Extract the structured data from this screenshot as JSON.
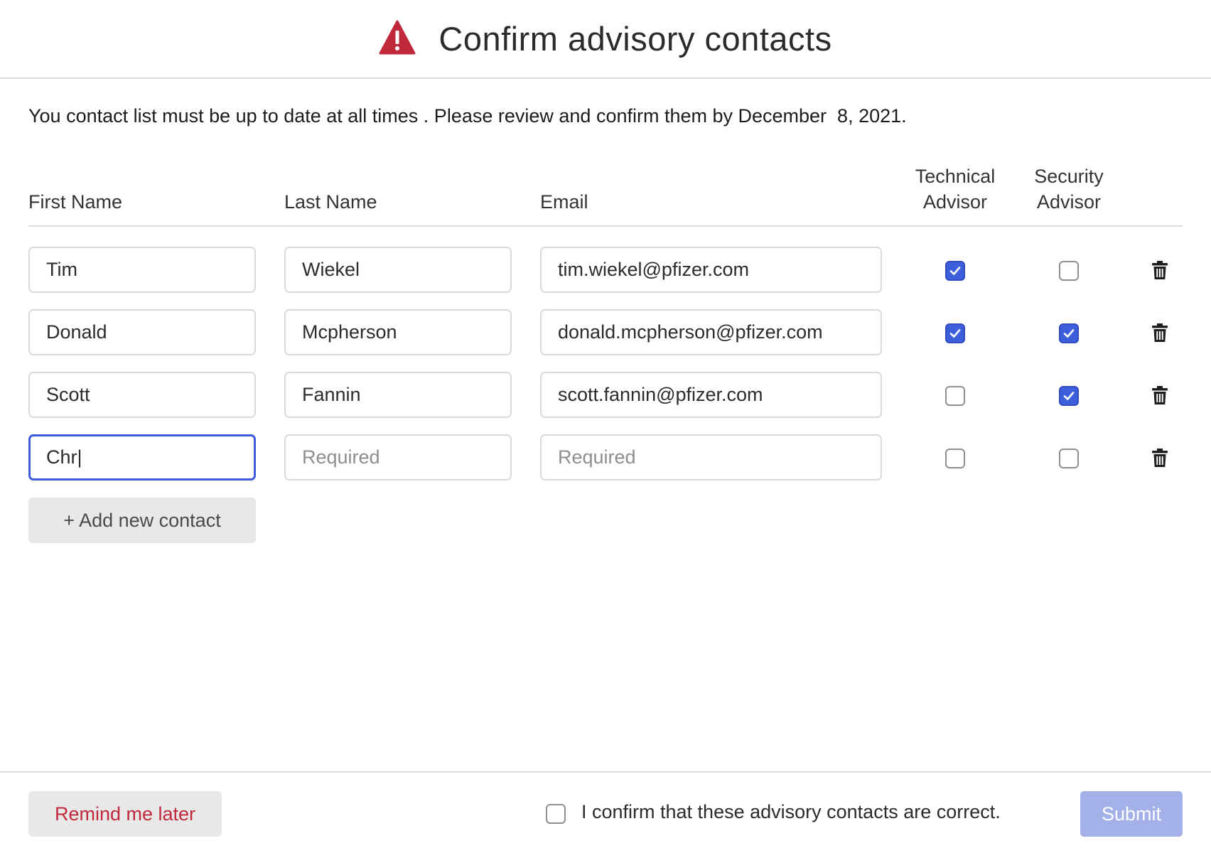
{
  "header": {
    "title": "Confirm advisory contacts",
    "icon": "warning-icon",
    "icon_color": "#c0283c"
  },
  "notice": "You contact list must be up to date at all times . Please review and confirm them by December  8, 2021.",
  "columns": {
    "first_name": "First Name",
    "last_name": "Last Name",
    "email": "Email",
    "technical_line1": "Technical",
    "technical_line2": "Advisor",
    "security_line1": "Security",
    "security_line2": "Advisor"
  },
  "rows": [
    {
      "first": "Tim",
      "last": "Wiekel",
      "email": "tim.wiekel@pfizer.com",
      "technical": true,
      "security": false
    },
    {
      "first": "Donald",
      "last": "Mcpherson",
      "email": "donald.mcpherson@pfizer.com",
      "technical": true,
      "security": true
    },
    {
      "first": "Scott",
      "last": "Fannin",
      "email": "scott.fannin@pfizer.com",
      "technical": false,
      "security": true
    },
    {
      "first": "Chr|",
      "last": "",
      "email": "",
      "last_placeholder": "Required",
      "email_placeholder": "Required",
      "technical": false,
      "security": false,
      "focused": true
    }
  ],
  "add_button": "+ Add new contact",
  "footer": {
    "remind_label": "Remind me later",
    "confirm_label": "I confirm that these advisory contacts are correct.",
    "confirm_checked": false,
    "submit_label": "Submit"
  },
  "colors": {
    "accent": "#3e5fdc",
    "danger": "#c0283c",
    "submit_disabled": "#a3b1e8"
  }
}
